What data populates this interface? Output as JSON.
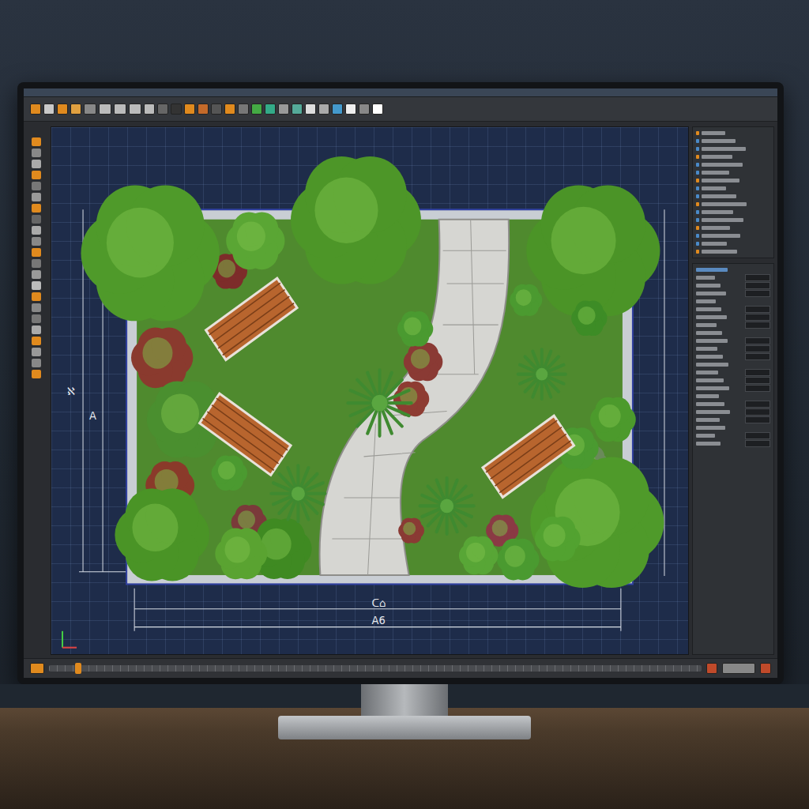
{
  "canvas": {
    "dimensions": {
      "bottom_inner": "ᑕ⌂",
      "bottom_outer": "A6",
      "left_upper": "ℵ",
      "left_lower": "A"
    }
  },
  "timeline": {
    "level": 0.04
  }
}
